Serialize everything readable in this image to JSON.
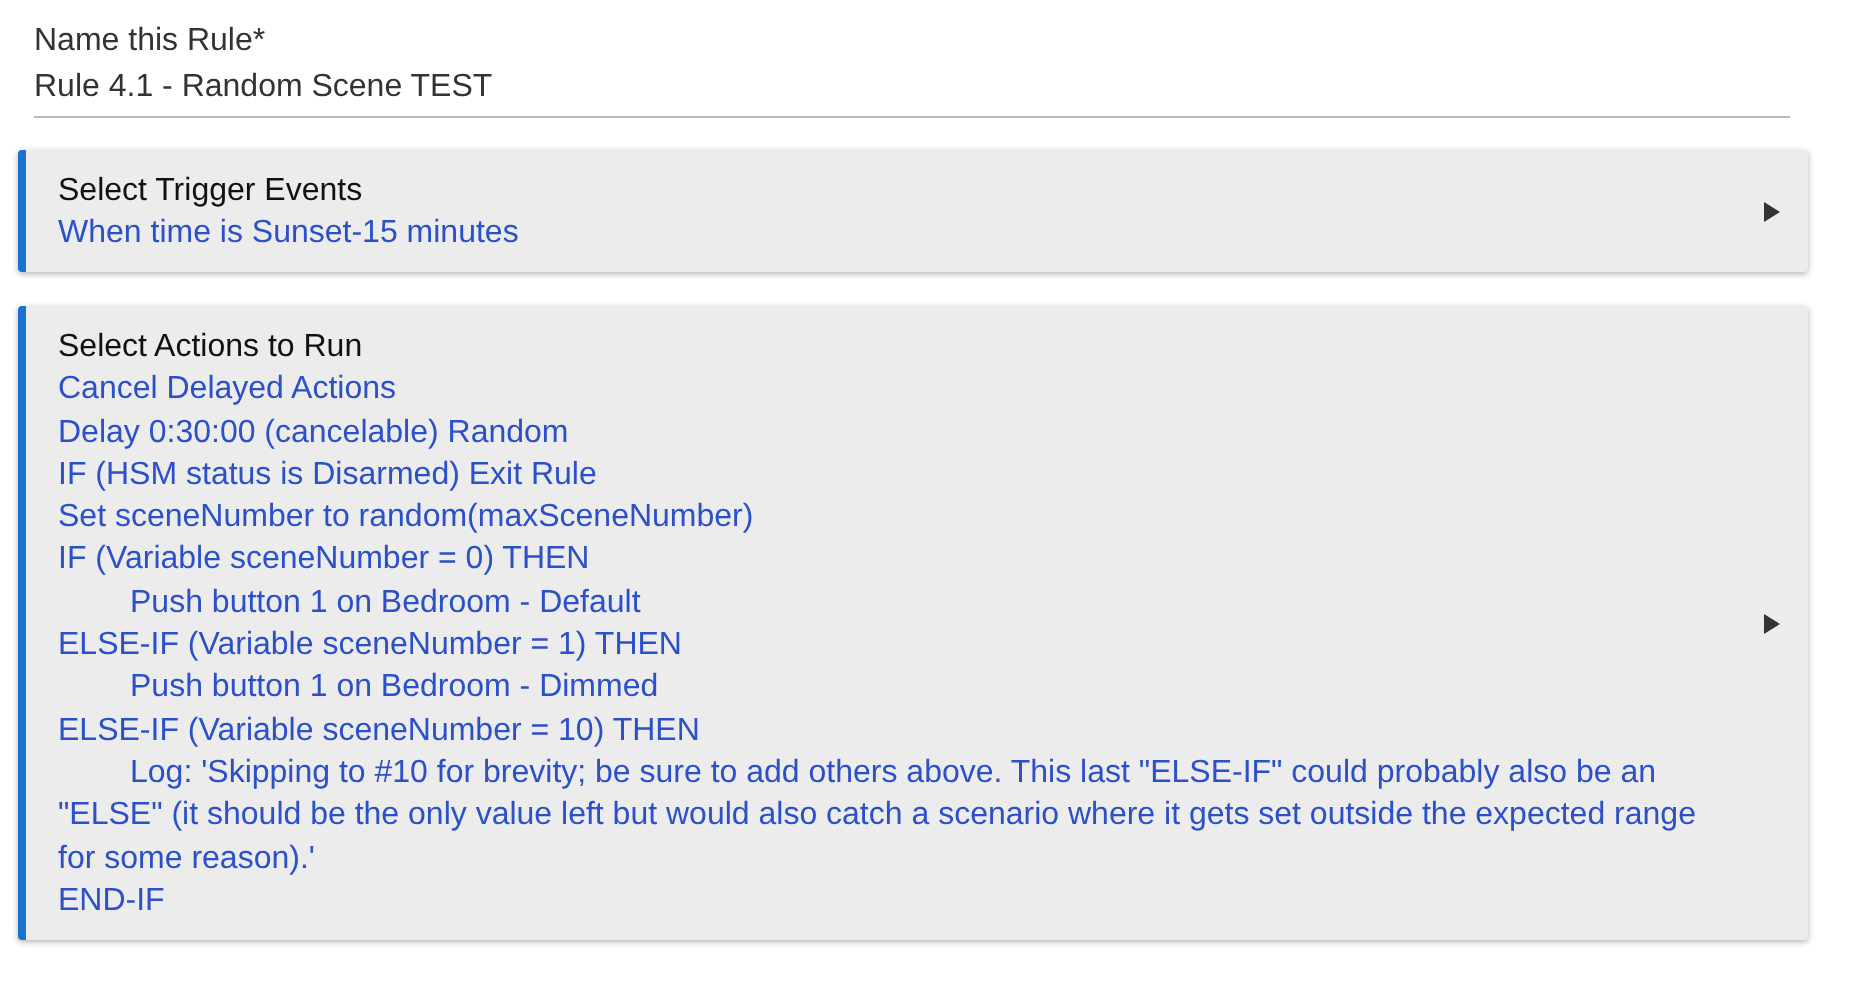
{
  "name_field": {
    "label": "Name this Rule*",
    "value": "Rule 4.1 - Random Scene TEST"
  },
  "sections": [
    {
      "title": "Select Trigger Events",
      "expanded": false,
      "lines": [
        {
          "text": "When time is Sunset-15 minutes"
        }
      ]
    },
    {
      "title": "Select Actions to Run",
      "expanded": false,
      "lines": [
        {
          "text": "Cancel Delayed Actions"
        },
        {
          "text": "Delay 0:30:00 (cancelable) Random"
        },
        {
          "text": "IF (HSM status is Disarmed) Exit Rule"
        },
        {
          "text": "Set sceneNumber to random(maxSceneNumber)"
        },
        {
          "text": "IF (Variable sceneNumber = 0) THEN",
          "children": [
            {
              "text": "Push button 1 on Bedroom - Default"
            }
          ]
        },
        {
          "text": "ELSE-IF (Variable sceneNumber = 1) THEN",
          "children": [
            {
              "text": "Push button 1 on Bedroom - Dimmed"
            }
          ]
        },
        {
          "text": "ELSE-IF (Variable sceneNumber = 10) THEN",
          "children": [
            {
              "text": "Log: 'Skipping to #10 for brevity; be sure to add others above. This last \"ELSE-IF\" could probably also be an \"ELSE\" (it should be the only value left but would also catch a scenario where it gets set outside the expected range for some reason).'"
            }
          ]
        },
        {
          "text": "END-IF"
        }
      ]
    }
  ]
}
